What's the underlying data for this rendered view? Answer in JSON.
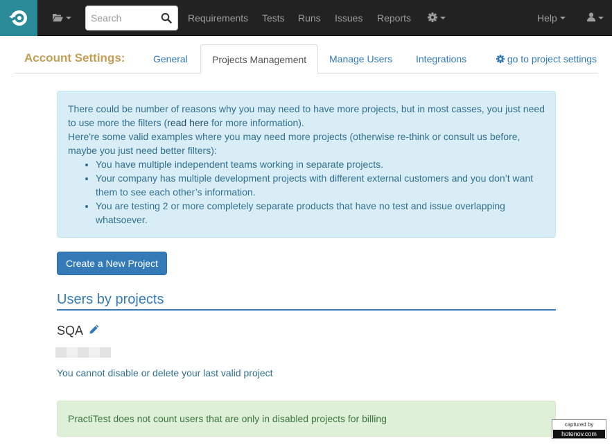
{
  "navbar": {
    "search_placeholder": "Search",
    "links": {
      "requirements": "Requirements",
      "tests": "Tests",
      "runs": "Runs",
      "issues": "Issues",
      "reports": "Reports",
      "help": "Help"
    },
    "icons": {
      "logo": "practitest-logo-icon",
      "folder": "folder-open-icon",
      "search": "search-icon",
      "settings": "gear-icon",
      "user": "user-icon"
    },
    "colors": {
      "background": "#222222",
      "logo_bg": "#2a8a97",
      "link": "#9d9d9d"
    }
  },
  "settings": {
    "title": "Account Settings:",
    "tabs": {
      "general": "General",
      "projects_management": "Projects Management",
      "manage_users": "Manage Users",
      "integrations": "Integrations"
    },
    "active_tab": "Projects Management",
    "project_settings_link": "go to project settings",
    "colors": {
      "title": "#c59e56",
      "link": "#337ab7"
    }
  },
  "info": {
    "line1_before": "There could be number of reasons why you may need to have more projects, but in most casses, you just need to use more the filters (",
    "line1_link": "read here",
    "line1_after": " for more information).",
    "line2": "Here're some valid examples where you may need more projects (otherwise re-think or consult us before, maybe you just need better filters):",
    "bullets": [
      "You have multiple independent teams working in separate projects.",
      "Your company has multiple development projects with different external customers and you don’t want them to see each other’s information.",
      "You are testing 2 or more completely separate products that have no test and issue overlapping whatsoever."
    ]
  },
  "create_button": "Create a New Project",
  "users_by_projects": {
    "title": "Users by projects",
    "project_name": "SQA",
    "edit_icon": "pencil-icon",
    "warning": "You cannot disable or delete your last valid project"
  },
  "billing_note": "PractiTest does not count users that are only in disabled projects for billing",
  "watermark": {
    "top": "captured by",
    "bottom": "hotenov.com"
  }
}
